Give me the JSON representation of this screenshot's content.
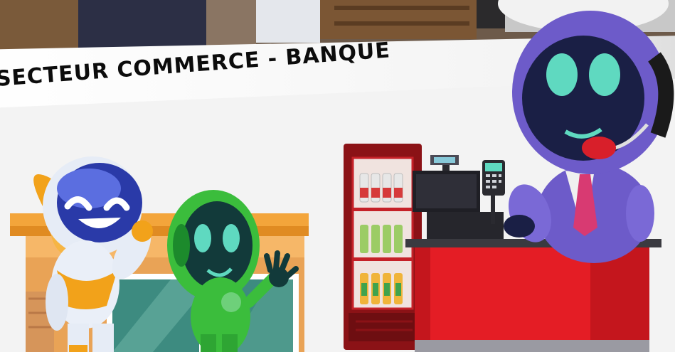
{
  "banner": {
    "title": "SECTEUR COMMERCE - BANQUE"
  },
  "scene": {
    "background_color": "#f3f3f3",
    "banner_color": "#ffffff",
    "counter_color": "#e41d25",
    "fridge_color": "#8b1216",
    "shopfront_color": "#f3a53b",
    "robots": [
      {
        "name": "white-orange-robot",
        "body_color": "#e9eef7",
        "visor_color": "#2a3aa8",
        "accent_color": "#f2a21a"
      },
      {
        "name": "green-robot",
        "body_color": "#3bbd3c",
        "visor_color": "#123a3a"
      },
      {
        "name": "purple-cashier-robot",
        "body_color": "#6d5bc9",
        "visor_color": "#1a1f45",
        "tie_color": "#d83a72"
      }
    ]
  }
}
